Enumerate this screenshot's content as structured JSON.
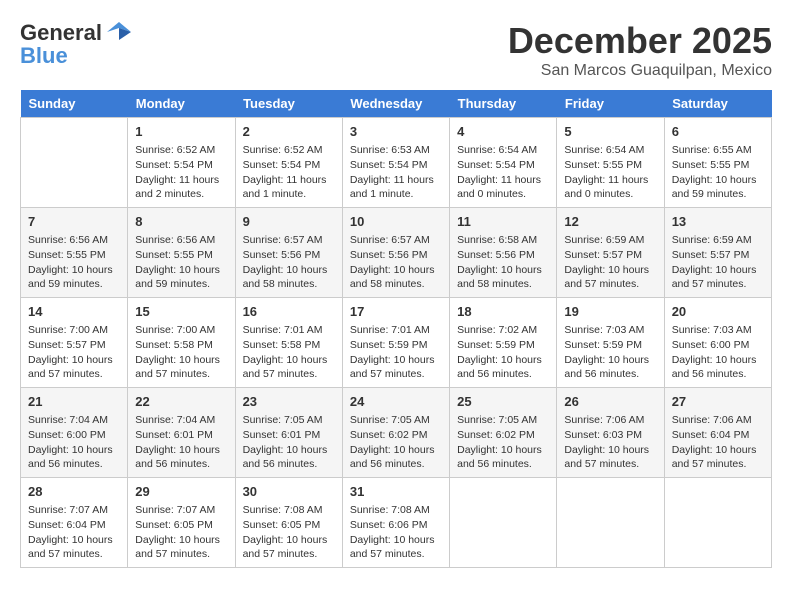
{
  "header": {
    "logo_line1": "General",
    "logo_line2": "Blue",
    "month": "December 2025",
    "location": "San Marcos Guaquilpan, Mexico"
  },
  "days_of_week": [
    "Sunday",
    "Monday",
    "Tuesday",
    "Wednesday",
    "Thursday",
    "Friday",
    "Saturday"
  ],
  "weeks": [
    [
      {
        "num": "",
        "info": ""
      },
      {
        "num": "1",
        "info": "Sunrise: 6:52 AM\nSunset: 5:54 PM\nDaylight: 11 hours\nand 2 minutes."
      },
      {
        "num": "2",
        "info": "Sunrise: 6:52 AM\nSunset: 5:54 PM\nDaylight: 11 hours\nand 1 minute."
      },
      {
        "num": "3",
        "info": "Sunrise: 6:53 AM\nSunset: 5:54 PM\nDaylight: 11 hours\nand 1 minute."
      },
      {
        "num": "4",
        "info": "Sunrise: 6:54 AM\nSunset: 5:54 PM\nDaylight: 11 hours\nand 0 minutes."
      },
      {
        "num": "5",
        "info": "Sunrise: 6:54 AM\nSunset: 5:55 PM\nDaylight: 11 hours\nand 0 minutes."
      },
      {
        "num": "6",
        "info": "Sunrise: 6:55 AM\nSunset: 5:55 PM\nDaylight: 10 hours\nand 59 minutes."
      }
    ],
    [
      {
        "num": "7",
        "info": "Sunrise: 6:56 AM\nSunset: 5:55 PM\nDaylight: 10 hours\nand 59 minutes."
      },
      {
        "num": "8",
        "info": "Sunrise: 6:56 AM\nSunset: 5:55 PM\nDaylight: 10 hours\nand 59 minutes."
      },
      {
        "num": "9",
        "info": "Sunrise: 6:57 AM\nSunset: 5:56 PM\nDaylight: 10 hours\nand 58 minutes."
      },
      {
        "num": "10",
        "info": "Sunrise: 6:57 AM\nSunset: 5:56 PM\nDaylight: 10 hours\nand 58 minutes."
      },
      {
        "num": "11",
        "info": "Sunrise: 6:58 AM\nSunset: 5:56 PM\nDaylight: 10 hours\nand 58 minutes."
      },
      {
        "num": "12",
        "info": "Sunrise: 6:59 AM\nSunset: 5:57 PM\nDaylight: 10 hours\nand 57 minutes."
      },
      {
        "num": "13",
        "info": "Sunrise: 6:59 AM\nSunset: 5:57 PM\nDaylight: 10 hours\nand 57 minutes."
      }
    ],
    [
      {
        "num": "14",
        "info": "Sunrise: 7:00 AM\nSunset: 5:57 PM\nDaylight: 10 hours\nand 57 minutes."
      },
      {
        "num": "15",
        "info": "Sunrise: 7:00 AM\nSunset: 5:58 PM\nDaylight: 10 hours\nand 57 minutes."
      },
      {
        "num": "16",
        "info": "Sunrise: 7:01 AM\nSunset: 5:58 PM\nDaylight: 10 hours\nand 57 minutes."
      },
      {
        "num": "17",
        "info": "Sunrise: 7:01 AM\nSunset: 5:59 PM\nDaylight: 10 hours\nand 57 minutes."
      },
      {
        "num": "18",
        "info": "Sunrise: 7:02 AM\nSunset: 5:59 PM\nDaylight: 10 hours\nand 56 minutes."
      },
      {
        "num": "19",
        "info": "Sunrise: 7:03 AM\nSunset: 5:59 PM\nDaylight: 10 hours\nand 56 minutes."
      },
      {
        "num": "20",
        "info": "Sunrise: 7:03 AM\nSunset: 6:00 PM\nDaylight: 10 hours\nand 56 minutes."
      }
    ],
    [
      {
        "num": "21",
        "info": "Sunrise: 7:04 AM\nSunset: 6:00 PM\nDaylight: 10 hours\nand 56 minutes."
      },
      {
        "num": "22",
        "info": "Sunrise: 7:04 AM\nSunset: 6:01 PM\nDaylight: 10 hours\nand 56 minutes."
      },
      {
        "num": "23",
        "info": "Sunrise: 7:05 AM\nSunset: 6:01 PM\nDaylight: 10 hours\nand 56 minutes."
      },
      {
        "num": "24",
        "info": "Sunrise: 7:05 AM\nSunset: 6:02 PM\nDaylight: 10 hours\nand 56 minutes."
      },
      {
        "num": "25",
        "info": "Sunrise: 7:05 AM\nSunset: 6:02 PM\nDaylight: 10 hours\nand 56 minutes."
      },
      {
        "num": "26",
        "info": "Sunrise: 7:06 AM\nSunset: 6:03 PM\nDaylight: 10 hours\nand 57 minutes."
      },
      {
        "num": "27",
        "info": "Sunrise: 7:06 AM\nSunset: 6:04 PM\nDaylight: 10 hours\nand 57 minutes."
      }
    ],
    [
      {
        "num": "28",
        "info": "Sunrise: 7:07 AM\nSunset: 6:04 PM\nDaylight: 10 hours\nand 57 minutes."
      },
      {
        "num": "29",
        "info": "Sunrise: 7:07 AM\nSunset: 6:05 PM\nDaylight: 10 hours\nand 57 minutes."
      },
      {
        "num": "30",
        "info": "Sunrise: 7:08 AM\nSunset: 6:05 PM\nDaylight: 10 hours\nand 57 minutes."
      },
      {
        "num": "31",
        "info": "Sunrise: 7:08 AM\nSunset: 6:06 PM\nDaylight: 10 hours\nand 57 minutes."
      },
      {
        "num": "",
        "info": ""
      },
      {
        "num": "",
        "info": ""
      },
      {
        "num": "",
        "info": ""
      }
    ]
  ]
}
